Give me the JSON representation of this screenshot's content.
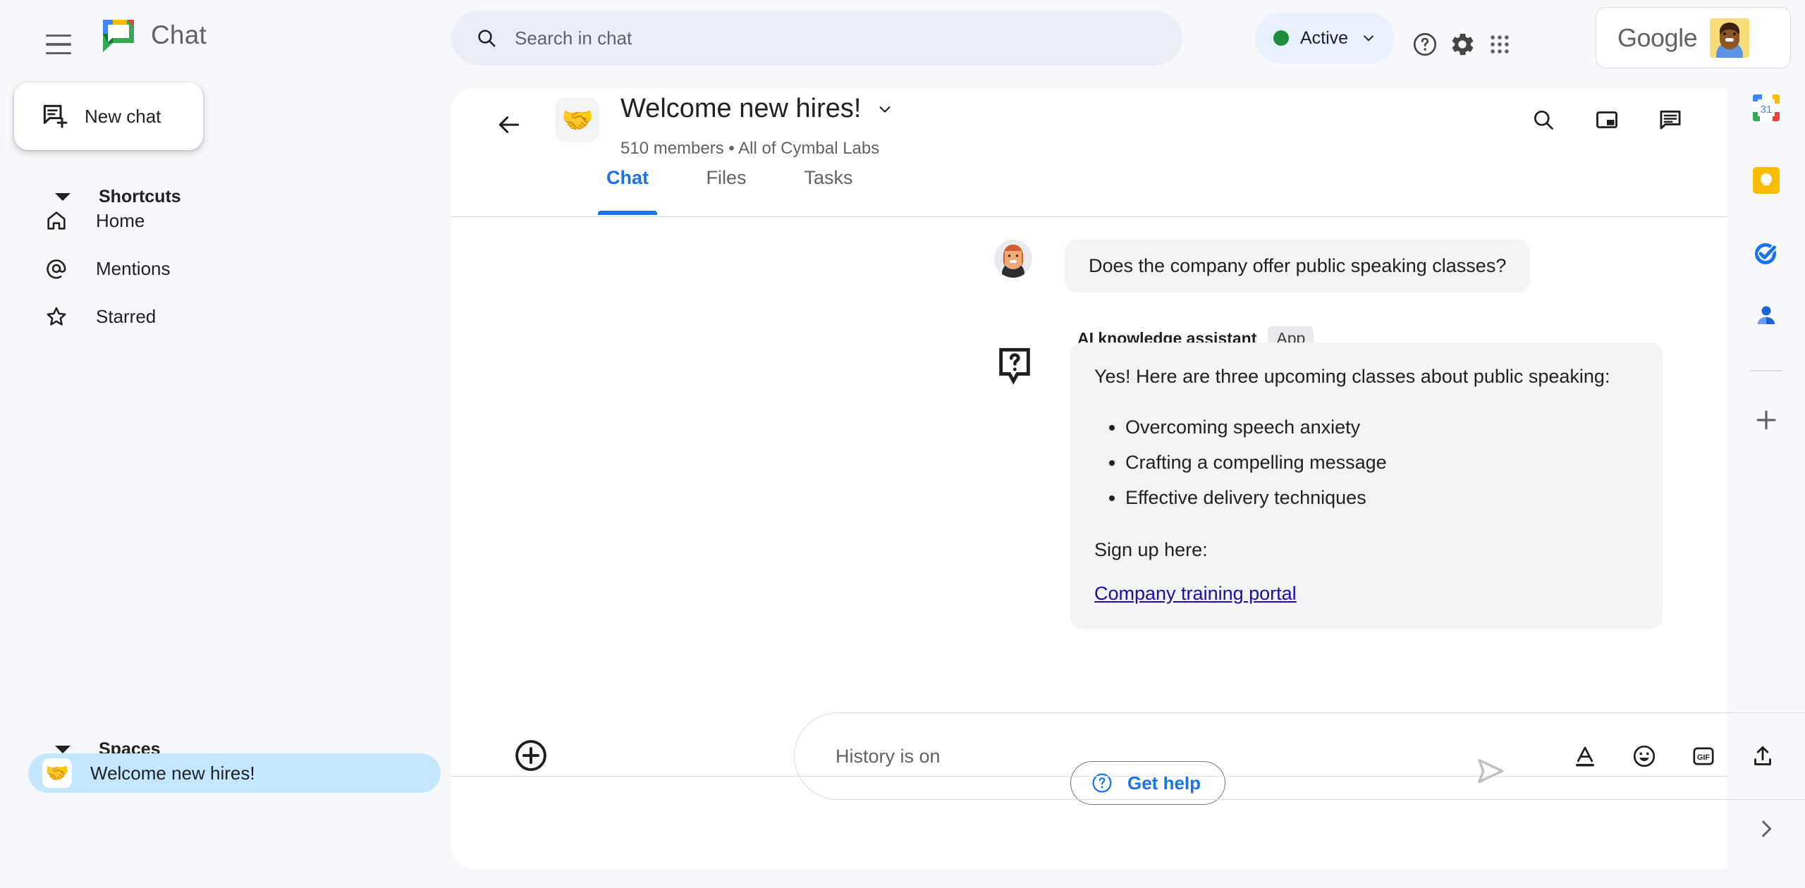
{
  "app": {
    "name": "Chat",
    "logo_icon": "google-chat-logo"
  },
  "topbar": {
    "menu_icon": "hamburger-menu-icon",
    "search": {
      "icon": "search-icon",
      "placeholder": "Search in chat",
      "value": ""
    },
    "status": {
      "label": "Active",
      "dot_color": "#1e8e3e",
      "chevron_icon": "chevron-down-icon"
    },
    "help_icon": "help-circle-icon",
    "settings_icon": "gear-icon",
    "apps_icon": "apps-grid-icon",
    "account": {
      "brand": "Google",
      "avatar_icon": "user-avatar"
    }
  },
  "sidebar": {
    "new_chat": {
      "label": "New chat",
      "icon": "new-chat-icon"
    },
    "shortcuts": {
      "title": "Shortcuts",
      "caret_icon": "caret-down-icon",
      "items": [
        {
          "label": "Home",
          "icon": "home-icon"
        },
        {
          "label": "Mentions",
          "icon": "at-mention-icon"
        },
        {
          "label": "Starred",
          "icon": "star-icon"
        }
      ]
    },
    "spaces": {
      "title": "Spaces",
      "caret_icon": "caret-down-icon",
      "items": [
        {
          "label": "Welcome new hires!",
          "emoji": "🤝",
          "selected": true
        }
      ]
    }
  },
  "chat_header": {
    "back_icon": "back-arrow-icon",
    "space_emoji": "🤝",
    "title": "Welcome new hires!",
    "title_chevron_icon": "chevron-down-icon",
    "subtitle": "510 members  •  All of Cymbal Labs",
    "actions": [
      {
        "name": "search-in-space-button",
        "icon": "search-icon"
      },
      {
        "name": "picture-in-picture-button",
        "icon": "pip-icon"
      },
      {
        "name": "open-chat-panel-button",
        "icon": "chat-bubble-icon"
      }
    ],
    "tabs": [
      {
        "label": "Chat",
        "active": true
      },
      {
        "label": "Files",
        "active": false
      },
      {
        "label": "Tasks",
        "active": false
      }
    ]
  },
  "conversation": {
    "user_message": {
      "avatar_icon": "user-avatar-woman",
      "text": "Does the company offer public speaking classes?"
    },
    "app_message": {
      "sender": "AI knowledge assistant",
      "badge": "App",
      "avatar_icon": "question-bubble-icon",
      "intro": "Yes! Here are three upcoming classes about public speaking:",
      "bullets": [
        "Overcoming speech anxiety",
        "Crafting a compelling message",
        "Effective delivery techniques"
      ],
      "signup_text": "Sign up here:",
      "link_text": "Company training portal",
      "link_color": "#1a0dab"
    },
    "get_help_button": {
      "label": "Get help",
      "icon": "help-circle-icon",
      "color": "#1a73e8"
    }
  },
  "composer": {
    "add_icon": "plus-circle-icon",
    "placeholder": "History is on",
    "value": "",
    "tools": [
      {
        "name": "format-text-button",
        "icon": "text-format-icon"
      },
      {
        "name": "emoji-button",
        "icon": "emoji-smiley-icon"
      },
      {
        "name": "gif-button",
        "icon": "gif-icon"
      },
      {
        "name": "upload-file-button",
        "icon": "upload-icon"
      },
      {
        "name": "add-video-meeting-button",
        "icon": "video-add-icon"
      }
    ],
    "send_icon": "send-icon"
  },
  "side_rail": {
    "apps": [
      {
        "name": "google-calendar",
        "icon": "calendar-31-icon"
      },
      {
        "name": "google-keep",
        "icon": "keep-bulb-icon"
      },
      {
        "name": "google-tasks",
        "icon": "tasks-check-icon"
      },
      {
        "name": "google-contacts",
        "icon": "contacts-person-icon"
      }
    ],
    "add_label": "",
    "add_icon": "plus-icon",
    "expand_icon": "chevron-right-icon"
  }
}
